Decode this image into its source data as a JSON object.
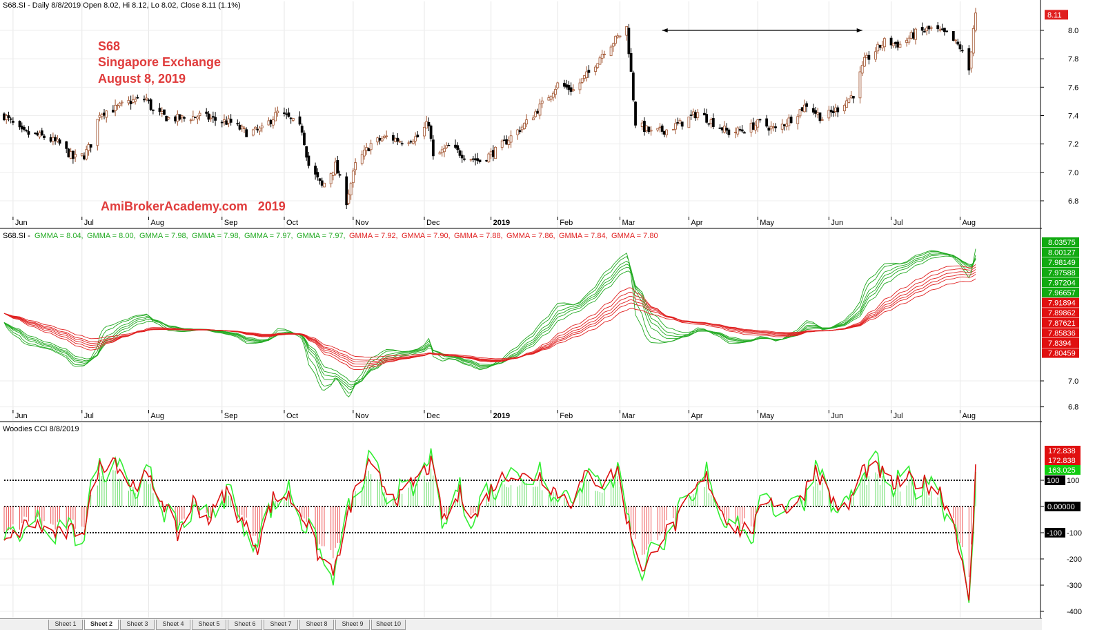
{
  "header": {
    "price_title": "S68.SI - Daily 8/8/2019 Open 8.02, Hi 8.12, Lo 8.02, Close 8.11 (1.1%)",
    "gmma_title_prefix": "S68.SI - ",
    "cci_title": "Woodies CCI   8/8/2019"
  },
  "annotations": {
    "ticker": "S68",
    "company": "Singapore Exchange",
    "date": "August 8, 2019",
    "watermark": "AmiBrokerAcademy.com   2019"
  },
  "colors": {
    "bull": "#a0522d",
    "bear": "#000000",
    "label_red": "#e03c3c",
    "green": "#22aa22",
    "red": "#e02020",
    "cci_green": "#33ee33",
    "cci_red": "#dd1111"
  },
  "x_axis": {
    "month_labels": [
      "Jun",
      "Jul",
      "Aug",
      "Sep",
      "Oct",
      "Nov",
      "Dec",
      "2019",
      "Feb",
      "Mar",
      "Apr",
      "May",
      "Jun",
      "Jul",
      "Aug"
    ]
  },
  "chart_data": [
    {
      "type": "candlestick",
      "title": "S68.SI - Daily 8/8/2019 Open 8.02, Hi 8.12, Lo 8.02, Close 8.11 (1.1%)",
      "ylim": [
        6.72,
        8.2
      ],
      "yticks": [
        "8.0",
        "7.8",
        "7.6",
        "7.4",
        "7.2",
        "7.0",
        "6.8"
      ],
      "last_value_label": "8.11",
      "close_path": [
        [
          "2018-05-28",
          7.4
        ],
        [
          "2018-06-05",
          7.28
        ],
        [
          "2018-06-15",
          7.25
        ],
        [
          "2018-06-22",
          7.2
        ],
        [
          "2018-06-28",
          7.1
        ],
        [
          "2018-07-03",
          7.12
        ],
        [
          "2018-07-06",
          7.2
        ],
        [
          "2018-07-10",
          7.42
        ],
        [
          "2018-07-17",
          7.45
        ],
        [
          "2018-07-24",
          7.5
        ],
        [
          "2018-07-31",
          7.52
        ],
        [
          "2018-08-03",
          7.43
        ],
        [
          "2018-08-10",
          7.38
        ],
        [
          "2018-08-17",
          7.38
        ],
        [
          "2018-08-24",
          7.4
        ],
        [
          "2018-08-31",
          7.37
        ],
        [
          "2018-09-07",
          7.35
        ],
        [
          "2018-09-14",
          7.28
        ],
        [
          "2018-09-21",
          7.3
        ],
        [
          "2018-09-28",
          7.42
        ],
        [
          "2018-10-03",
          7.38
        ],
        [
          "2018-10-09",
          7.3
        ],
        [
          "2018-10-12",
          7.05
        ],
        [
          "2018-10-18",
          6.9
        ],
        [
          "2018-10-24",
          7.05
        ],
        [
          "2018-10-29",
          6.8
        ],
        [
          "2018-11-02",
          7.05
        ],
        [
          "2018-11-09",
          7.2
        ],
        [
          "2018-11-16",
          7.25
        ],
        [
          "2018-11-23",
          7.22
        ],
        [
          "2018-11-30",
          7.25
        ],
        [
          "2018-12-05",
          7.35
        ],
        [
          "2018-12-07",
          7.1
        ],
        [
          "2018-12-14",
          7.18
        ],
        [
          "2018-12-21",
          7.12
        ],
        [
          "2018-12-28",
          7.08
        ],
        [
          "2019-01-04",
          7.15
        ],
        [
          "2019-01-11",
          7.25
        ],
        [
          "2019-01-18",
          7.35
        ],
        [
          "2019-01-25",
          7.48
        ],
        [
          "2019-02-01",
          7.62
        ],
        [
          "2019-02-08",
          7.58
        ],
        [
          "2019-02-15",
          7.7
        ],
        [
          "2019-02-22",
          7.86
        ],
        [
          "2019-02-28",
          7.95
        ],
        [
          "2019-03-04",
          8.02
        ],
        [
          "2019-03-06",
          7.7
        ],
        [
          "2019-03-08",
          7.35
        ],
        [
          "2019-03-15",
          7.28
        ],
        [
          "2019-03-22",
          7.3
        ],
        [
          "2019-03-29",
          7.35
        ],
        [
          "2019-04-05",
          7.42
        ],
        [
          "2019-04-12",
          7.35
        ],
        [
          "2019-04-19",
          7.28
        ],
        [
          "2019-04-26",
          7.3
        ],
        [
          "2019-05-03",
          7.35
        ],
        [
          "2019-05-10",
          7.3
        ],
        [
          "2019-05-17",
          7.38
        ],
        [
          "2019-05-24",
          7.48
        ],
        [
          "2019-05-31",
          7.38
        ],
        [
          "2019-06-07",
          7.45
        ],
        [
          "2019-06-14",
          7.55
        ],
        [
          "2019-06-19",
          7.78
        ],
        [
          "2019-06-28",
          7.92
        ],
        [
          "2019-07-05",
          7.9
        ],
        [
          "2019-07-12",
          7.98
        ],
        [
          "2019-07-19",
          8.01
        ],
        [
          "2019-07-26",
          7.97
        ],
        [
          "2019-08-01",
          7.88
        ],
        [
          "2019-08-05",
          7.72
        ],
        [
          "2019-08-07",
          8.02
        ],
        [
          "2019-08-08",
          8.11
        ]
      ],
      "arrow_line": {
        "x": [
          "2019-03-20",
          "2019-06-18"
        ],
        "y": 8.0
      }
    },
    {
      "type": "line",
      "title": "GMMA",
      "ylim": [
        6.72,
        8.2
      ],
      "yticks": [
        "7.0",
        "6.8"
      ],
      "series": [
        {
          "name": "GMMA",
          "value": "8.04",
          "color": "#22aa22",
          "label": "8.03575"
        },
        {
          "name": "GMMA",
          "value": "8.00",
          "color": "#22aa22",
          "label": "8.00127"
        },
        {
          "name": "GMMA",
          "value": "7.98",
          "color": "#22aa22",
          "label": "7.98149"
        },
        {
          "name": "GMMA",
          "value": "7.98",
          "color": "#22aa22",
          "label": "7.97588"
        },
        {
          "name": "GMMA",
          "value": "7.97",
          "color": "#22aa22",
          "label": "7.97204"
        },
        {
          "name": "GMMA",
          "value": "7.97",
          "color": "#22aa22",
          "label": "7.96657"
        },
        {
          "name": "GMMA",
          "value": "7.92",
          "color": "#e02020",
          "label": "7.91894"
        },
        {
          "name": "GMMA",
          "value": "7.90",
          "color": "#e02020",
          "label": "7.89862"
        },
        {
          "name": "GMMA",
          "value": "7.88",
          "color": "#e02020",
          "label": "7.87621"
        },
        {
          "name": "GMMA",
          "value": "7.86",
          "color": "#e02020",
          "label": "7.85836"
        },
        {
          "name": "GMMA",
          "value": "7.84",
          "color": "#e02020",
          "label": "7.8394"
        },
        {
          "name": "GMMA",
          "value": "7.80",
          "color": "#e02020",
          "label": "7.80459"
        }
      ]
    },
    {
      "type": "line",
      "title": "Woodies CCI   8/8/2019",
      "ylim": [
        -410,
        250
      ],
      "yticks": [
        "100",
        "0.00000",
        "-100",
        "-200",
        "-300",
        "-400"
      ],
      "reference_lines": [
        100,
        0,
        -100
      ],
      "right_labels": [
        "172.838",
        "172.838",
        "163.025",
        "100",
        "0.00000",
        "-100"
      ],
      "anchors": [
        [
          "2018-05-28",
          -150
        ],
        [
          "2018-06-08",
          -60
        ],
        [
          "2018-06-22",
          -110
        ],
        [
          "2018-07-03",
          -80
        ],
        [
          "2018-07-09",
          140
        ],
        [
          "2018-07-16",
          190
        ],
        [
          "2018-07-24",
          80
        ],
        [
          "2018-07-31",
          110
        ],
        [
          "2018-08-07",
          30
        ],
        [
          "2018-08-14",
          -110
        ],
        [
          "2018-08-21",
          20
        ],
        [
          "2018-08-28",
          -50
        ],
        [
          "2018-09-05",
          60
        ],
        [
          "2018-09-12",
          -60
        ],
        [
          "2018-09-19",
          -150
        ],
        [
          "2018-09-26",
          30
        ],
        [
          "2018-10-03",
          40
        ],
        [
          "2018-10-10",
          -40
        ],
        [
          "2018-10-17",
          -200
        ],
        [
          "2018-10-24",
          -240
        ],
        [
          "2018-11-01",
          40
        ],
        [
          "2018-11-08",
          150
        ],
        [
          "2018-11-15",
          80
        ],
        [
          "2018-11-22",
          30
        ],
        [
          "2018-11-29",
          100
        ],
        [
          "2018-12-06",
          160
        ],
        [
          "2018-12-12",
          -60
        ],
        [
          "2018-12-19",
          50
        ],
        [
          "2018-12-26",
          -40
        ],
        [
          "2019-01-03",
          80
        ],
        [
          "2019-01-10",
          130
        ],
        [
          "2019-01-17",
          110
        ],
        [
          "2019-01-24",
          120
        ],
        [
          "2019-01-31",
          60
        ],
        [
          "2019-02-07",
          20
        ],
        [
          "2019-02-14",
          120
        ],
        [
          "2019-02-21",
          90
        ],
        [
          "2019-02-28",
          140
        ],
        [
          "2019-03-05",
          -80
        ],
        [
          "2019-03-12",
          -250
        ],
        [
          "2019-03-19",
          -120
        ],
        [
          "2019-03-26",
          -70
        ],
        [
          "2019-04-02",
          40
        ],
        [
          "2019-04-09",
          110
        ],
        [
          "2019-04-16",
          -20
        ],
        [
          "2019-04-23",
          -90
        ],
        [
          "2019-04-30",
          -80
        ],
        [
          "2019-05-07",
          40
        ],
        [
          "2019-05-14",
          -10
        ],
        [
          "2019-05-21",
          20
        ],
        [
          "2019-05-28",
          150
        ],
        [
          "2019-06-04",
          30
        ],
        [
          "2019-06-11",
          -20
        ],
        [
          "2019-06-18",
          140
        ],
        [
          "2019-06-25",
          140
        ],
        [
          "2019-07-02",
          80
        ],
        [
          "2019-07-09",
          100
        ],
        [
          "2019-07-16",
          90
        ],
        [
          "2019-07-23",
          60
        ],
        [
          "2019-07-30",
          -80
        ],
        [
          "2019-08-05",
          -380
        ],
        [
          "2019-08-07",
          -50
        ],
        [
          "2019-08-08",
          173
        ]
      ]
    }
  ],
  "tabs": [
    "Sheet 1",
    "Sheet 2",
    "Sheet 3",
    "Sheet 4",
    "Sheet 5",
    "Sheet 6",
    "Sheet 7",
    "Sheet 8",
    "Sheet 9",
    "Sheet 10"
  ]
}
